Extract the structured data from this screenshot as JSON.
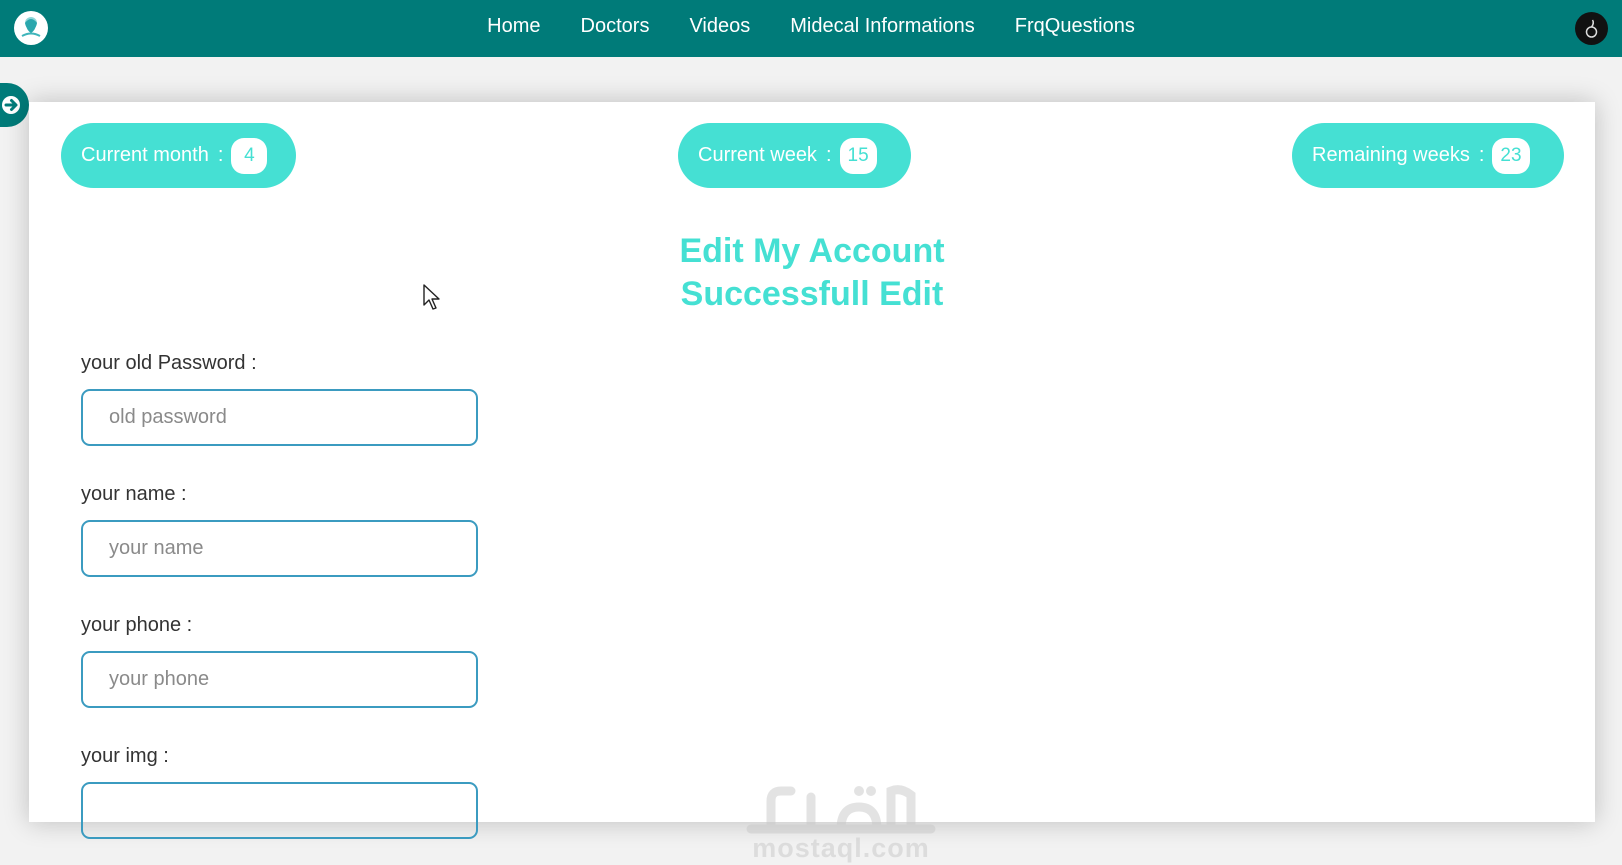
{
  "nav": {
    "items": [
      {
        "label": "Home"
      },
      {
        "label": "Doctors"
      },
      {
        "label": "Videos"
      },
      {
        "label": "Midecal Informations"
      },
      {
        "label": "FrqQuestions"
      }
    ]
  },
  "icons": {
    "logo": "app-logo-icon",
    "profile": "profile-avatar-icon",
    "sidebar_toggle": "arrow-right-icon",
    "cursor": "mouse-cursor-icon"
  },
  "stats": {
    "current_month": {
      "label": "Current month",
      "separator": ":",
      "value": "4"
    },
    "current_week": {
      "label": "Current week",
      "separator": ":",
      "value": "15"
    },
    "remaining_weeks": {
      "label": "Remaining weeks",
      "separator": ":",
      "value": "23"
    }
  },
  "page": {
    "title": "Edit My Account",
    "success_message": "Successfull Edit"
  },
  "form": {
    "old_password": {
      "label": "your old Password :",
      "placeholder": "old password",
      "value": ""
    },
    "name": {
      "label": "your name :",
      "placeholder": "your name",
      "value": ""
    },
    "phone": {
      "label": "your phone :",
      "placeholder": "your phone",
      "value": ""
    },
    "img": {
      "label": "your img :"
    }
  },
  "watermark": {
    "text": "mostaql.com"
  },
  "colors": {
    "navbar": "#007b79",
    "accent": "#45e0d3",
    "input_border": "#3b9bc0"
  }
}
